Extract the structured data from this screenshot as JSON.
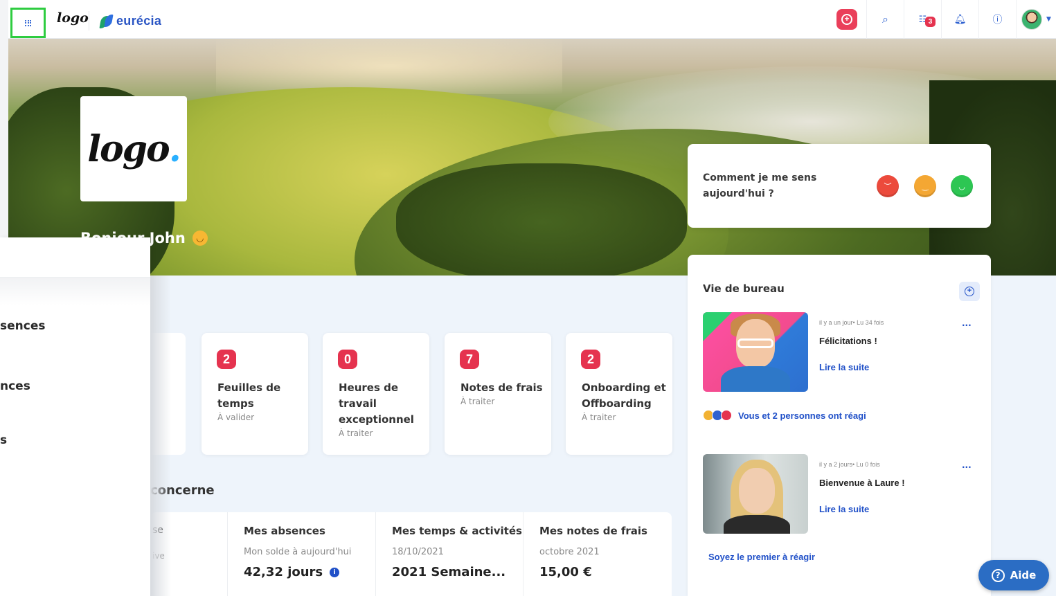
{
  "topbar": {
    "logo_text": "logo",
    "brand": "eurécia",
    "badge_count": "3",
    "icons": [
      "grid-icon",
      "plus-circle-icon",
      "search-icon",
      "tasks-icon",
      "bell-icon",
      "help-circle-icon",
      "avatar",
      "chevron-down-icon"
    ]
  },
  "hero": {
    "logo_text": "logo",
    "greeting": "Bonjour John"
  },
  "mood": {
    "question": "Comment je me sens aujourd'hui ?"
  },
  "dropdown": {
    "items": [
      "sences",
      "nces",
      "s"
    ]
  },
  "tiles": [
    {
      "count": "2",
      "title": "Feuilles de temps",
      "status": "À valider"
    },
    {
      "count": "0",
      "title": "Heures de travail exceptionnel",
      "status": "À traiter"
    },
    {
      "count": "7",
      "title": "Notes de frais",
      "status": "À traiter"
    },
    {
      "count": "2",
      "title": "Onboarding et Offboarding",
      "status": "À traiter"
    }
  ],
  "section": {
    "title": "concerne"
  },
  "bottom": {
    "cut_top": "se",
    "cut_bottom": "ive",
    "cols": [
      {
        "title": "Mes absences",
        "sub": "Mon solde à aujourd'hui",
        "value": "42,32 jours"
      },
      {
        "title": "Mes temps & activités",
        "sub": "18/10/2021",
        "value": "2021 Semaine..."
      },
      {
        "title": "Mes notes de frais",
        "sub": "octobre 2021",
        "value": "15,00 €"
      }
    ]
  },
  "office": {
    "title": "Vie de bureau",
    "posts": [
      {
        "meta": "il y a un jour• Lu 34 fois",
        "title": "Félicitations !",
        "link": "Lire la suite",
        "dots": "..."
      },
      {
        "meta": "il y a 2 jours• Lu 0 fois",
        "title": "Bienvenue à Laure !",
        "link": "Lire la suite",
        "dots": "..."
      }
    ],
    "reactions": "Vous et 2 personnes ont réagi",
    "first_react": "Soyez le premier à réagir"
  },
  "help": {
    "label": "Aide"
  },
  "colors": {
    "accent": "#e5334f",
    "link": "#2050c8",
    "focus": "#2ecc40"
  }
}
